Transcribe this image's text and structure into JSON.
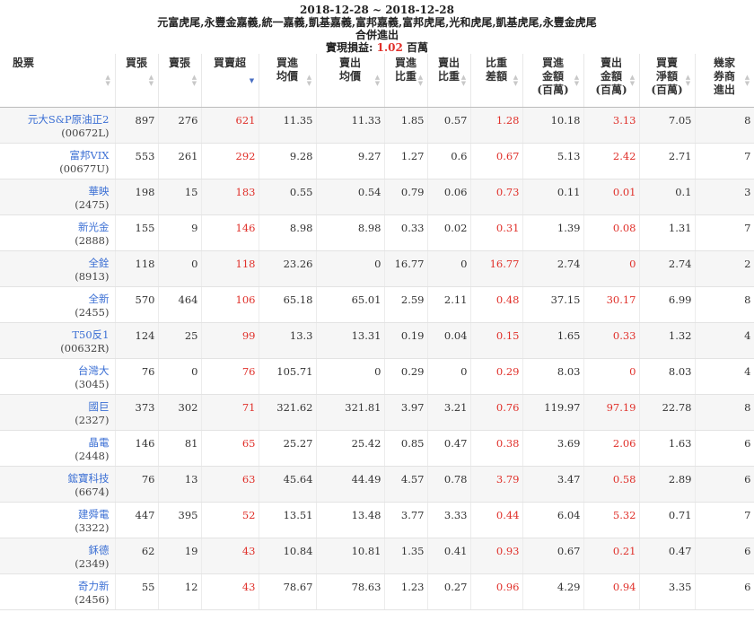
{
  "header": {
    "date_range": "2018-12-28 ~ 2018-12-28",
    "brokers": "元富虎尾,永豐金嘉義,統一嘉義,凱基嘉義,富邦嘉義,富邦虎尾,光和虎尾,凱基虎尾,永豐金虎尾",
    "mode": "合併進出",
    "pl_label": "實現損益: ",
    "pl_value": "1.02",
    "pl_unit": " 百萬"
  },
  "columns": [
    {
      "key": "stock",
      "label": "股票",
      "label2": ""
    },
    {
      "key": "buy",
      "label": "買張",
      "label2": ""
    },
    {
      "key": "sell",
      "label": "賣張",
      "label2": ""
    },
    {
      "key": "net",
      "label": "買賣超",
      "label2": ""
    },
    {
      "key": "buy_avg",
      "label": "買進",
      "label2": "均價"
    },
    {
      "key": "sell_avg",
      "label": "賣出",
      "label2": "均價"
    },
    {
      "key": "buy_ratio",
      "label": "買進",
      "label2": "比重"
    },
    {
      "key": "sell_ratio",
      "label": "賣出",
      "label2": "比重"
    },
    {
      "key": "ratio_diff",
      "label": "比重",
      "label2": "差額"
    },
    {
      "key": "buy_amt",
      "label": "買進",
      "label2": "金額",
      "label3": "(百萬)"
    },
    {
      "key": "sell_amt",
      "label": "賣出",
      "label2": "金額",
      "label3": "(百萬)"
    },
    {
      "key": "float_amt",
      "label": "買賣",
      "label2": "淨額",
      "label3": "(百萬)"
    },
    {
      "key": "brokers",
      "label": "幾家",
      "label2": "券商",
      "label3": "進出"
    }
  ],
  "rows": [
    {
      "name": "元大S&P原油正2",
      "code": "(00672L)",
      "buy": "897",
      "sell": "276",
      "net": "621",
      "buy_avg": "11.35",
      "sell_avg": "11.33",
      "buy_ratio": "1.85",
      "sell_ratio": "0.57",
      "ratio_diff": "1.28",
      "buy_amt": "10.18",
      "sell_amt": "3.13",
      "float_amt": "7.05",
      "brokers": "8"
    },
    {
      "name": "富邦VIX",
      "code": "(00677U)",
      "buy": "553",
      "sell": "261",
      "net": "292",
      "buy_avg": "9.28",
      "sell_avg": "9.27",
      "buy_ratio": "1.27",
      "sell_ratio": "0.6",
      "ratio_diff": "0.67",
      "buy_amt": "5.13",
      "sell_amt": "2.42",
      "float_amt": "2.71",
      "brokers": "7"
    },
    {
      "name": "華映",
      "code": "(2475)",
      "buy": "198",
      "sell": "15",
      "net": "183",
      "buy_avg": "0.55",
      "sell_avg": "0.54",
      "buy_ratio": "0.79",
      "sell_ratio": "0.06",
      "ratio_diff": "0.73",
      "buy_amt": "0.11",
      "sell_amt": "0.01",
      "float_amt": "0.1",
      "brokers": "3"
    },
    {
      "name": "新光金",
      "code": "(2888)",
      "buy": "155",
      "sell": "9",
      "net": "146",
      "buy_avg": "8.98",
      "sell_avg": "8.98",
      "buy_ratio": "0.33",
      "sell_ratio": "0.02",
      "ratio_diff": "0.31",
      "buy_amt": "1.39",
      "sell_amt": "0.08",
      "float_amt": "1.31",
      "brokers": "7"
    },
    {
      "name": "全銓",
      "code": "(8913)",
      "buy": "118",
      "sell": "0",
      "net": "118",
      "buy_avg": "23.26",
      "sell_avg": "0",
      "buy_ratio": "16.77",
      "sell_ratio": "0",
      "ratio_diff": "16.77",
      "buy_amt": "2.74",
      "sell_amt": "0",
      "float_amt": "2.74",
      "brokers": "2"
    },
    {
      "name": "全新",
      "code": "(2455)",
      "buy": "570",
      "sell": "464",
      "net": "106",
      "buy_avg": "65.18",
      "sell_avg": "65.01",
      "buy_ratio": "2.59",
      "sell_ratio": "2.11",
      "ratio_diff": "0.48",
      "buy_amt": "37.15",
      "sell_amt": "30.17",
      "float_amt": "6.99",
      "brokers": "8"
    },
    {
      "name": "T50反1",
      "code": "(00632R)",
      "buy": "124",
      "sell": "25",
      "net": "99",
      "buy_avg": "13.3",
      "sell_avg": "13.31",
      "buy_ratio": "0.19",
      "sell_ratio": "0.04",
      "ratio_diff": "0.15",
      "buy_amt": "1.65",
      "sell_amt": "0.33",
      "float_amt": "1.32",
      "brokers": "4"
    },
    {
      "name": "台灣大",
      "code": "(3045)",
      "buy": "76",
      "sell": "0",
      "net": "76",
      "buy_avg": "105.71",
      "sell_avg": "0",
      "buy_ratio": "0.29",
      "sell_ratio": "0",
      "ratio_diff": "0.29",
      "buy_amt": "8.03",
      "sell_amt": "0",
      "float_amt": "8.03",
      "brokers": "4"
    },
    {
      "name": "國巨",
      "code": "(2327)",
      "buy": "373",
      "sell": "302",
      "net": "71",
      "buy_avg": "321.62",
      "sell_avg": "321.81",
      "buy_ratio": "3.97",
      "sell_ratio": "3.21",
      "ratio_diff": "0.76",
      "buy_amt": "119.97",
      "sell_amt": "97.19",
      "float_amt": "22.78",
      "brokers": "8"
    },
    {
      "name": "晶電",
      "code": "(2448)",
      "buy": "146",
      "sell": "81",
      "net": "65",
      "buy_avg": "25.27",
      "sell_avg": "25.42",
      "buy_ratio": "0.85",
      "sell_ratio": "0.47",
      "ratio_diff": "0.38",
      "buy_amt": "3.69",
      "sell_amt": "2.06",
      "float_amt": "1.63",
      "brokers": "6"
    },
    {
      "name": "鋐寶科技",
      "code": "(6674)",
      "buy": "76",
      "sell": "13",
      "net": "63",
      "buy_avg": "45.64",
      "sell_avg": "44.49",
      "buy_ratio": "4.57",
      "sell_ratio": "0.78",
      "ratio_diff": "3.79",
      "buy_amt": "3.47",
      "sell_amt": "0.58",
      "float_amt": "2.89",
      "brokers": "6"
    },
    {
      "name": "建舜電",
      "code": "(3322)",
      "buy": "447",
      "sell": "395",
      "net": "52",
      "buy_avg": "13.51",
      "sell_avg": "13.48",
      "buy_ratio": "3.77",
      "sell_ratio": "3.33",
      "ratio_diff": "0.44",
      "buy_amt": "6.04",
      "sell_amt": "5.32",
      "float_amt": "0.71",
      "brokers": "7"
    },
    {
      "name": "鉌德",
      "code": "(2349)",
      "buy": "62",
      "sell": "19",
      "net": "43",
      "buy_avg": "10.84",
      "sell_avg": "10.81",
      "buy_ratio": "1.35",
      "sell_ratio": "0.41",
      "ratio_diff": "0.93",
      "buy_amt": "0.67",
      "sell_amt": "0.21",
      "float_amt": "0.47",
      "brokers": "6"
    },
    {
      "name": "奇力新",
      "code": "(2456)",
      "buy": "55",
      "sell": "12",
      "net": "43",
      "buy_avg": "78.67",
      "sell_avg": "78.63",
      "buy_ratio": "1.23",
      "sell_ratio": "0.27",
      "ratio_diff": "0.96",
      "buy_amt": "4.29",
      "sell_amt": "0.94",
      "float_amt": "3.35",
      "brokers": "6"
    }
  ],
  "colors": {
    "accent_red": "#e0302a",
    "link_blue": "#3b6fd4",
    "sort_active": "#4a6fc3"
  }
}
